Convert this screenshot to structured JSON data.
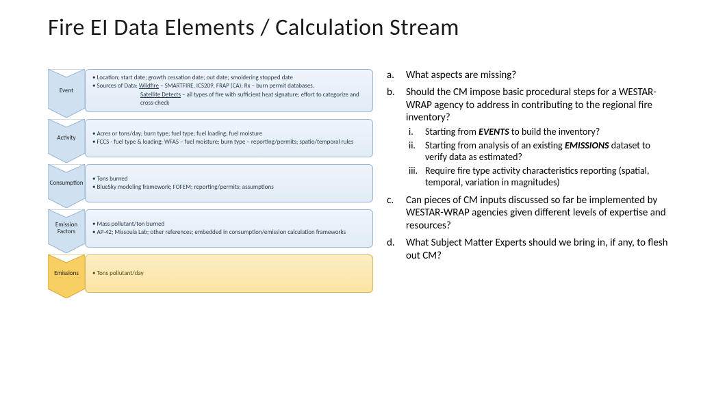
{
  "title": "Fire EI Data Elements / Calculation Stream",
  "colors": {
    "blueFill": "#cfe0f1",
    "blueStroke": "#9ab6d6",
    "goldFill": "#f8cf62",
    "goldStroke": "#d9a93a"
  },
  "stream": [
    {
      "label": "Event",
      "style": "blue",
      "lines": [
        "Location; start date; growth cessation date; out date; smoldering stopped date",
        "Sources of Data: <u>Wildfire</u> – SMARTFIRE, ICS209, FRAP (CA); Rx – burn permit databases."
      ],
      "extra": "<u>Satellite Detects</u> – all types of fire with sufficient heat signature; effort to categorize and cross-check"
    },
    {
      "label": "Activity",
      "style": "blue",
      "lines": [
        "Acres or tons/day; burn type; fuel type; fuel loading; fuel moisture",
        "FCCS - fuel type & loading; WFAS – fuel moisture; burn type – reporting/permits; spatio/temporal rules"
      ]
    },
    {
      "label": "Consumption",
      "style": "blue",
      "lines": [
        "Tons burned",
        "BlueSky modeling framework; FOFEM; reporting/permits; assumptions"
      ]
    },
    {
      "label": "Emission Factors",
      "style": "blue",
      "lines": [
        "Mass pollutant/ton burned",
        "AP-42; Missoula Lab; other references; embedded in consumption/emission calculation frameworks"
      ]
    },
    {
      "label": "Emissions",
      "style": "gold",
      "lines": [
        "Tons pollutant/day"
      ]
    }
  ],
  "questions": [
    {
      "mk": "a.",
      "text": "What aspects are missing?"
    },
    {
      "mk": "b.",
      "text": "Should the CM impose basic procedural steps for a WESTAR-WRAP agency to address in contributing to the regional fire inventory?",
      "sub": [
        {
          "mk": "i.",
          "html": "Starting from <span class='bi'>EVENTS</span> to build the inventory?"
        },
        {
          "mk": "ii.",
          "html": "Starting from analysis of an existing <span class='bi'>EMISSIONS</span> dataset to verify data as estimated?"
        },
        {
          "mk": "iii.",
          "html": "Require fire type activity characteristics reporting (spatial, temporal, variation in magnitudes)"
        }
      ]
    },
    {
      "mk": "c.",
      "text": "Can pieces of CM inputs discussed so far be implemented by WESTAR-WRAP agencies given different levels of expertise and resources?"
    },
    {
      "mk": "d.",
      "text": "What Subject Matter Experts should we bring in, if any, to flesh out CM?"
    }
  ]
}
